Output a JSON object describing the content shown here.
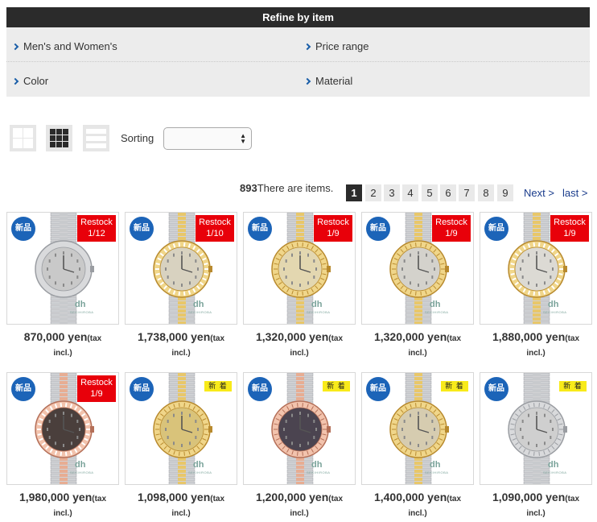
{
  "refine": {
    "title": "Refine by item",
    "items": [
      "Men's and Women's",
      "Price range",
      "Color",
      "Material"
    ]
  },
  "toolbar": {
    "view_icons": [
      "grid-2x2-icon",
      "grid-3x3-icon",
      "list-icon"
    ],
    "sorting_label": "Sorting",
    "sorting_value": ""
  },
  "results": {
    "count": "893",
    "count_suffix": "There are items.",
    "pages": [
      "1",
      "2",
      "3",
      "4",
      "5",
      "6",
      "7",
      "8",
      "9"
    ],
    "current_page": "1",
    "next_label": "Next >",
    "last_label": "last >"
  },
  "products": [
    {
      "new_label": "新品",
      "badge_type": "restock",
      "badge_line1": "Restock",
      "badge_line2": "1/12",
      "price": "870,000 yen",
      "tax_a": "(tax",
      "tax_b": "incl.)",
      "case": "steel",
      "bracelet": "steel",
      "dial": "#c9c9c9",
      "bezel": "smooth"
    },
    {
      "new_label": "新品",
      "badge_type": "restock",
      "badge_line1": "Restock",
      "badge_line2": "1/10",
      "price": "1,738,000 yen",
      "tax_a": "(tax",
      "tax_b": "incl.)",
      "case": "gold",
      "bracelet": "two-tone",
      "dial": "#d8d2c0",
      "bezel": "diamond"
    },
    {
      "new_label": "新品",
      "badge_type": "restock",
      "badge_line1": "Restock",
      "badge_line2": "1/9",
      "price": "1,320,000 yen",
      "tax_a": "(tax",
      "tax_b": "incl.)",
      "case": "gold",
      "bracelet": "two-tone",
      "dial": "#e3d7b0",
      "bezel": "fluted"
    },
    {
      "new_label": "新品",
      "badge_type": "restock",
      "badge_line1": "Restock",
      "badge_line2": "1/9",
      "price": "1,320,000 yen",
      "tax_a": "(tax",
      "tax_b": "incl.)",
      "case": "gold",
      "bracelet": "two-tone",
      "dial": "#d4d2cc",
      "bezel": "fluted"
    },
    {
      "new_label": "新品",
      "badge_type": "restock",
      "badge_line1": "Restock",
      "badge_line2": "1/9",
      "price": "1,880,000 yen",
      "tax_a": "(tax",
      "tax_b": "incl.)",
      "case": "gold",
      "bracelet": "two-tone",
      "dial": "#dcdad4",
      "bezel": "diamond"
    },
    {
      "new_label": "新品",
      "badge_type": "restock",
      "badge_line1": "Restock",
      "badge_line2": "1/9",
      "price": "1,980,000 yen",
      "tax_a": "(tax",
      "tax_b": "incl.)",
      "case": "rose",
      "bracelet": "rose-tone",
      "dial": "#4a3f3c",
      "bezel": "diamond"
    },
    {
      "new_label": "新品",
      "badge_type": "new",
      "badge_line1": "新 着",
      "badge_line2": "",
      "price": "1,098,000 yen",
      "tax_a": "(tax",
      "tax_b": "incl.)",
      "case": "gold",
      "bracelet": "two-tone",
      "dial": "#d9c37a",
      "bezel": "fluted"
    },
    {
      "new_label": "新品",
      "badge_type": "new",
      "badge_line1": "新 着",
      "badge_line2": "",
      "price": "1,200,000 yen",
      "tax_a": "(tax",
      "tax_b": "incl.)",
      "case": "rose",
      "bracelet": "rose-tone",
      "dial": "#4b4450",
      "bezel": "fluted"
    },
    {
      "new_label": "新品",
      "badge_type": "new",
      "badge_line1": "新 着",
      "badge_line2": "",
      "price": "1,400,000 yen",
      "tax_a": "(tax",
      "tax_b": "incl.)",
      "case": "gold",
      "bracelet": "two-tone",
      "dial": "#d6ccb0",
      "bezel": "fluted"
    },
    {
      "new_label": "新品",
      "badge_type": "new",
      "badge_line1": "新 着",
      "badge_line2": "",
      "price": "1,090,000 yen",
      "tax_a": "(tax",
      "tax_b": "incl.)",
      "case": "steel",
      "bracelet": "steel",
      "dial": "#cfcfcf",
      "bezel": "fluted"
    }
  ],
  "watermark": {
    "logo": "dh",
    "text": "SEKIHIROBA"
  },
  "colors": {
    "header": "#2b2b2b",
    "new_circle": "#1c64b8",
    "restock": "#e8000a",
    "new_arrival": "#f8ea1a",
    "link": "#1a3c8c"
  }
}
